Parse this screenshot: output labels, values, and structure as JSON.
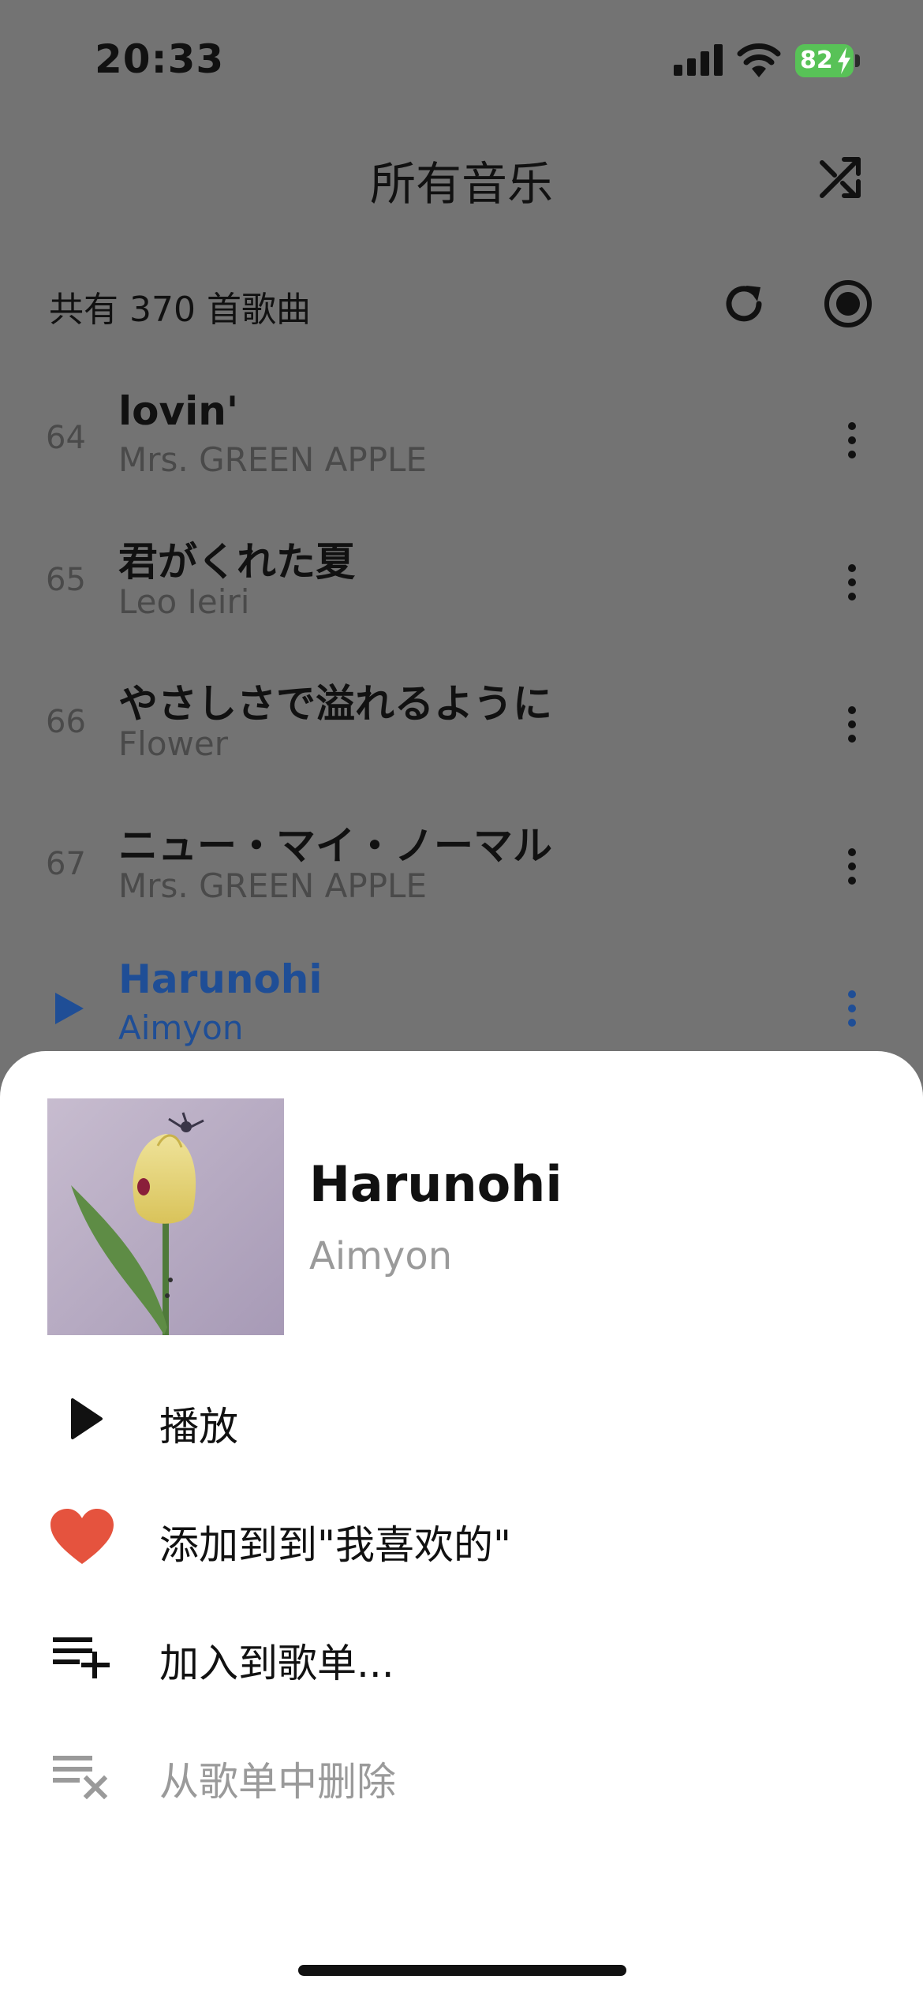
{
  "status_bar": {
    "time": "20:33",
    "battery_level": "82",
    "battery_color": "#58c257"
  },
  "header": {
    "title": "所有音乐",
    "shuffle_icon": "shuffle-icon"
  },
  "list_info": {
    "count_text": "共有 370 首歌曲",
    "refresh_icon": "refresh-icon",
    "locate_icon": "locate-current-icon"
  },
  "songs": [
    {
      "index": "64",
      "title": "lovin'",
      "artist": "Mrs. GREEN APPLE"
    },
    {
      "index": "65",
      "title": "君がくれた夏",
      "artist": "Leo Ieiri"
    },
    {
      "index": "66",
      "title": "やさしさで溢れるように",
      "artist": "Flower"
    },
    {
      "index": "67",
      "title": "ニュー・マイ・ノーマル",
      "artist": "Mrs. GREEN APPLE"
    },
    {
      "index": "",
      "title": "Harunohi",
      "artist": "Aimyon",
      "playing": true
    }
  ],
  "sheet": {
    "title": "Harunohi",
    "artist": "Aimyon",
    "actions": [
      {
        "label": "播放",
        "icon": "play-icon"
      },
      {
        "label": "添加到到\"我喜欢的\"",
        "icon": "heart-icon"
      },
      {
        "label": "加入到歌单...",
        "icon": "playlist-add-icon"
      },
      {
        "label": "从歌单中删除",
        "icon": "playlist-remove-icon",
        "disabled": true
      }
    ]
  },
  "colors": {
    "accent": "#1f4e96",
    "heart": "#e5533e",
    "overlay": "#737373"
  }
}
